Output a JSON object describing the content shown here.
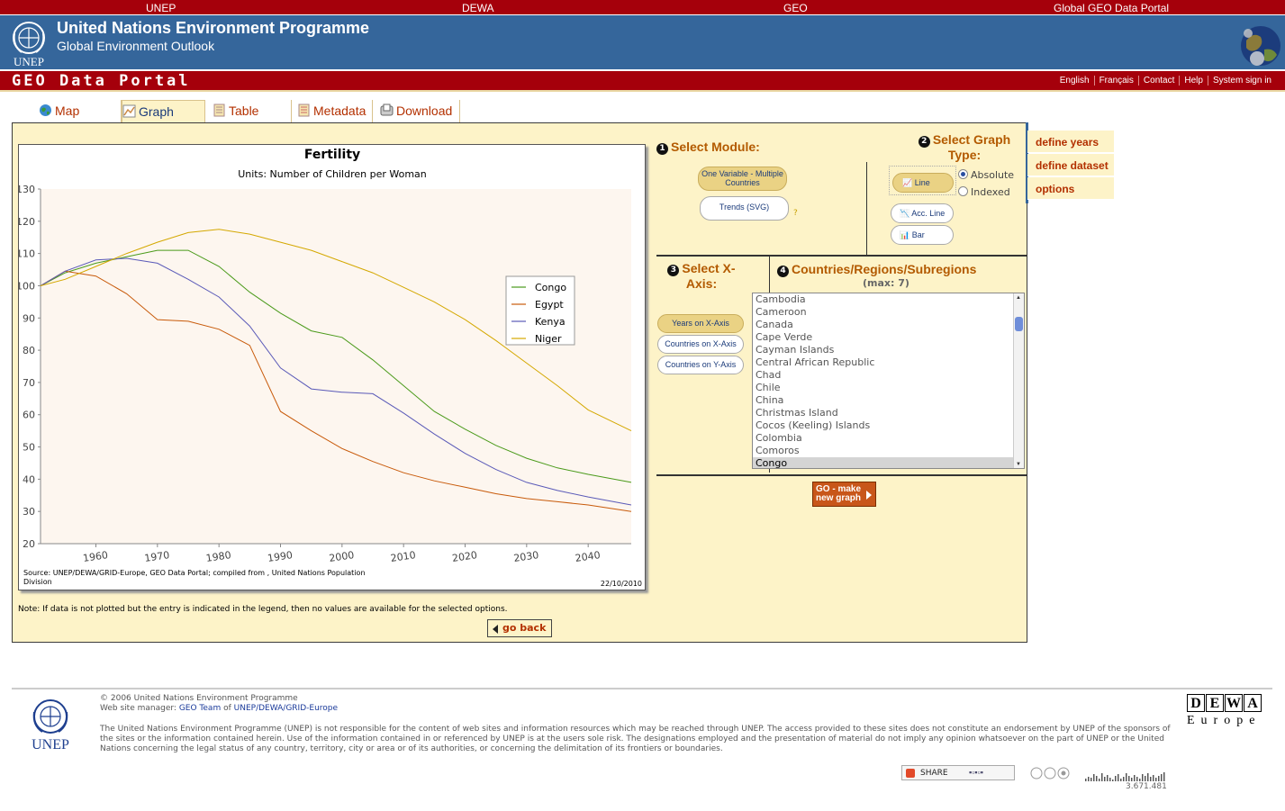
{
  "topbar": {
    "links": [
      "UNEP",
      "DEWA",
      "GEO",
      "Global GEO Data Portal"
    ]
  },
  "header": {
    "title": "United Nations Environment Programme",
    "subtitle": "Global Environment Outlook",
    "logo_text": "UNEP"
  },
  "portal": {
    "title": "GEO Data Portal",
    "links": [
      "English",
      "Français",
      "Contact",
      "Help",
      "System sign in"
    ]
  },
  "tabs": [
    {
      "label": "Map",
      "icon": "globe-icon"
    },
    {
      "label": "Graph",
      "icon": "graph-icon",
      "active": true
    },
    {
      "label": "Table",
      "icon": "table-icon"
    },
    {
      "label": "Metadata",
      "icon": "metadata-icon"
    },
    {
      "label": "Download",
      "icon": "download-icon"
    }
  ],
  "chart_data": {
    "type": "line",
    "title": "Fertility",
    "subtitle": "Units: Number of Children per Woman",
    "x_ticks": [
      1960,
      1970,
      1980,
      1990,
      2000,
      2010,
      2020,
      2030,
      2040
    ],
    "y_ticks": [
      20,
      30,
      40,
      50,
      60,
      70,
      80,
      90,
      100,
      110,
      120,
      130
    ],
    "xlim": [
      1951,
      2047
    ],
    "ylim": [
      20,
      130
    ],
    "legend_position": "right",
    "series": [
      {
        "name": "Congo",
        "color": "#4a9a1a",
        "x": [
          1951,
          1955,
          1960,
          1965,
          1970,
          1975,
          1980,
          1985,
          1990,
          1995,
          2000,
          2005,
          2010,
          2015,
          2020,
          2025,
          2030,
          2035,
          2040,
          2047
        ],
        "y": [
          100,
          104,
          107,
          109,
          111,
          111,
          106,
          98,
          91.5,
          86,
          84,
          77,
          69,
          61,
          55.5,
          50.5,
          46.5,
          43.5,
          41.5,
          39
        ]
      },
      {
        "name": "Egypt",
        "color": "#c85a0a",
        "x": [
          1951,
          1955,
          1960,
          1965,
          1970,
          1975,
          1980,
          1985,
          1990,
          1995,
          2000,
          2005,
          2010,
          2015,
          2020,
          2025,
          2030,
          2035,
          2040,
          2047
        ],
        "y": [
          100,
          104.5,
          103,
          97.5,
          89.5,
          89,
          86.5,
          81.5,
          61,
          55,
          49.5,
          45.5,
          42,
          39.5,
          37.5,
          35.5,
          34,
          33,
          32,
          30
        ]
      },
      {
        "name": "Kenya",
        "color": "#5a5ab8",
        "x": [
          1951,
          1955,
          1960,
          1965,
          1970,
          1975,
          1980,
          1985,
          1990,
          1995,
          2000,
          2005,
          2010,
          2015,
          2020,
          2025,
          2030,
          2035,
          2040,
          2047
        ],
        "y": [
          100,
          104.5,
          108,
          108.5,
          107,
          102,
          96.5,
          87.5,
          74.5,
          68,
          67,
          66.5,
          60.5,
          54,
          48,
          43,
          39,
          36.5,
          34.5,
          32
        ]
      },
      {
        "name": "Niger",
        "color": "#d4a800",
        "x": [
          1951,
          1955,
          1960,
          1965,
          1970,
          1975,
          1980,
          1985,
          1990,
          1995,
          2000,
          2005,
          2010,
          2015,
          2020,
          2025,
          2030,
          2035,
          2040,
          2047
        ],
        "y": [
          100,
          102,
          106,
          110,
          113.5,
          116.5,
          117.5,
          116,
          113.5,
          111,
          107.5,
          104,
          99.5,
          95,
          89.5,
          83,
          76,
          69,
          61.5,
          55
        ]
      }
    ],
    "source": "Source: UNEP/DEWA/GRID-Europe, GEO Data Portal; compiled from , United Nations Population Division",
    "date": "22/10/2010"
  },
  "note": "Note: If data is not plotted but the entry is indicated in the legend, then no values are available for the selected options.",
  "go_back": "go back",
  "controls": {
    "step1": "Select Module:",
    "module_buttons": [
      "One Variable - Multiple Countries",
      "Trends (SVG)"
    ],
    "help_mark": "?",
    "step2": "Select Graph Type:",
    "graph_types": [
      "Line",
      "Acc. Line",
      "Bar"
    ],
    "radio": [
      "Absolute",
      "Indexed"
    ],
    "step3": "Select X-Axis:",
    "axis_buttons": [
      "Years on X-Axis",
      "Countries on X-Axis",
      "Countries on Y-Axis"
    ],
    "step4": "Countries/Regions/Subregions",
    "max": "(max: 7)",
    "countries": [
      "Cambodia",
      "Cameroon",
      "Canada",
      "Cape Verde",
      "Cayman Islands",
      "Central African Republic",
      "Chad",
      "Chile",
      "China",
      "Christmas Island",
      "Cocos (Keeling) Islands",
      "Colombia",
      "Comoros",
      "Congo"
    ],
    "selected_country": "Congo",
    "go_button": "GO - make new graph"
  },
  "sidemenu": [
    "define years",
    "define dataset",
    "options"
  ],
  "footer": {
    "copyright": "© 2006 United Nations Environment Programme",
    "webmanager_prefix": "Web site manager:",
    "webmanager_team": "GEO Team",
    "webmanager_of": "of",
    "webmanager_org": "UNEP/DEWA/GRID-Europe",
    "disclaimer": "The United Nations Environment Programme (UNEP) is not responsible for the content of web sites and information resources which may be reached through UNEP. The access provided to these sites does not constitute an endorsement by UNEP of the sponsors of the sites or the information contained herein. Use of the information contained in or referenced by UNEP is at the users sole risk. The designations employed and the presentation of material do not imply any opinion whatsoever on the part of UNEP or the United Nations concerning the legal status of any country, territory, city or area or of its authorities, or concerning the delimitation of its frontiers or boundaries.",
    "logo_text": "UNEP",
    "dewa_letters": [
      "D",
      "E",
      "W",
      "A"
    ],
    "dewa_sub": "Europe",
    "share": "SHARE",
    "counter": "3.671.481"
  }
}
